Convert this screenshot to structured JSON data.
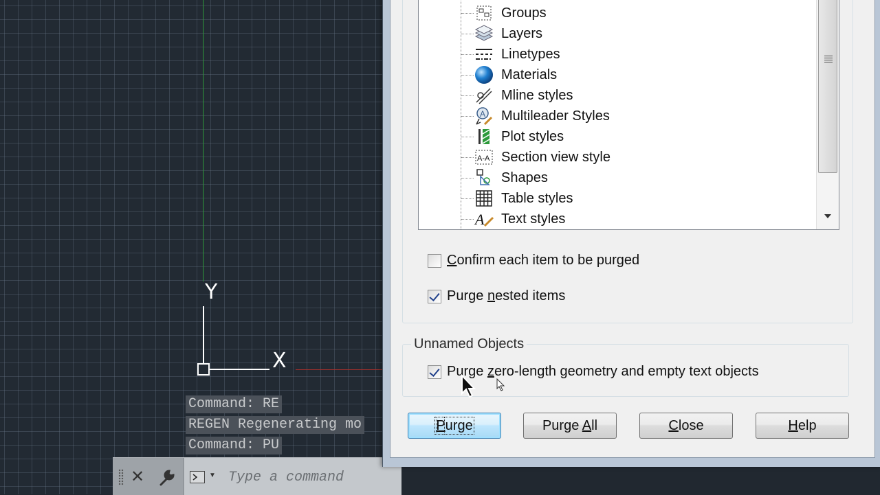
{
  "canvas": {
    "ucs_y_label": "Y",
    "ucs_x_label": "X",
    "command_history": [
      "Command: RE",
      "REGEN Regenerating mo",
      "Command: PU"
    ]
  },
  "command_bar": {
    "close_icon": "close-icon",
    "settings_icon": "wrench-icon",
    "prompt_icon": "command-prompt-icon",
    "placeholder": "Type a command"
  },
  "dialog": {
    "tree_items": [
      {
        "label": "Groups",
        "icon": "groups-icon"
      },
      {
        "label": "Layers",
        "icon": "layers-icon"
      },
      {
        "label": "Linetypes",
        "icon": "linetypes-icon"
      },
      {
        "label": "Materials",
        "icon": "materials-icon"
      },
      {
        "label": "Mline styles",
        "icon": "mline-styles-icon"
      },
      {
        "label": "Multileader Styles",
        "icon": "multileader-styles-icon"
      },
      {
        "label": "Plot styles",
        "icon": "plot-styles-icon"
      },
      {
        "label": "Section view style",
        "icon": "section-view-style-icon"
      },
      {
        "label": "Shapes",
        "icon": "shapes-icon"
      },
      {
        "label": "Table styles",
        "icon": "table-styles-icon"
      },
      {
        "label": "Text styles",
        "icon": "text-styles-icon"
      }
    ],
    "confirm_each": {
      "pre": "",
      "key": "C",
      "post": "onfirm each item to be purged",
      "checked": false
    },
    "purge_nested": {
      "pre": "Purge ",
      "key": "n",
      "post": "ested items",
      "checked": true
    },
    "unnamed_title": "Unnamed Objects",
    "purge_zero": {
      "pre": "Purge ",
      "key": "z",
      "post": "ero-length geometry and empty text objects",
      "checked": true
    },
    "buttons": {
      "purge": {
        "pre": "",
        "key": "P",
        "post": "urge"
      },
      "purge_all": {
        "pre": "Purge ",
        "key": "A",
        "post": "ll"
      },
      "close": {
        "pre": "",
        "key": "C",
        "post": "lose"
      },
      "help": {
        "pre": "",
        "key": "H",
        "post": "elp"
      }
    }
  },
  "colors": {
    "canvas_bg": "#222a33",
    "y_axis": "#2e9a3a",
    "x_axis": "#a8302c",
    "default_button_border": "#3c7fb1"
  }
}
